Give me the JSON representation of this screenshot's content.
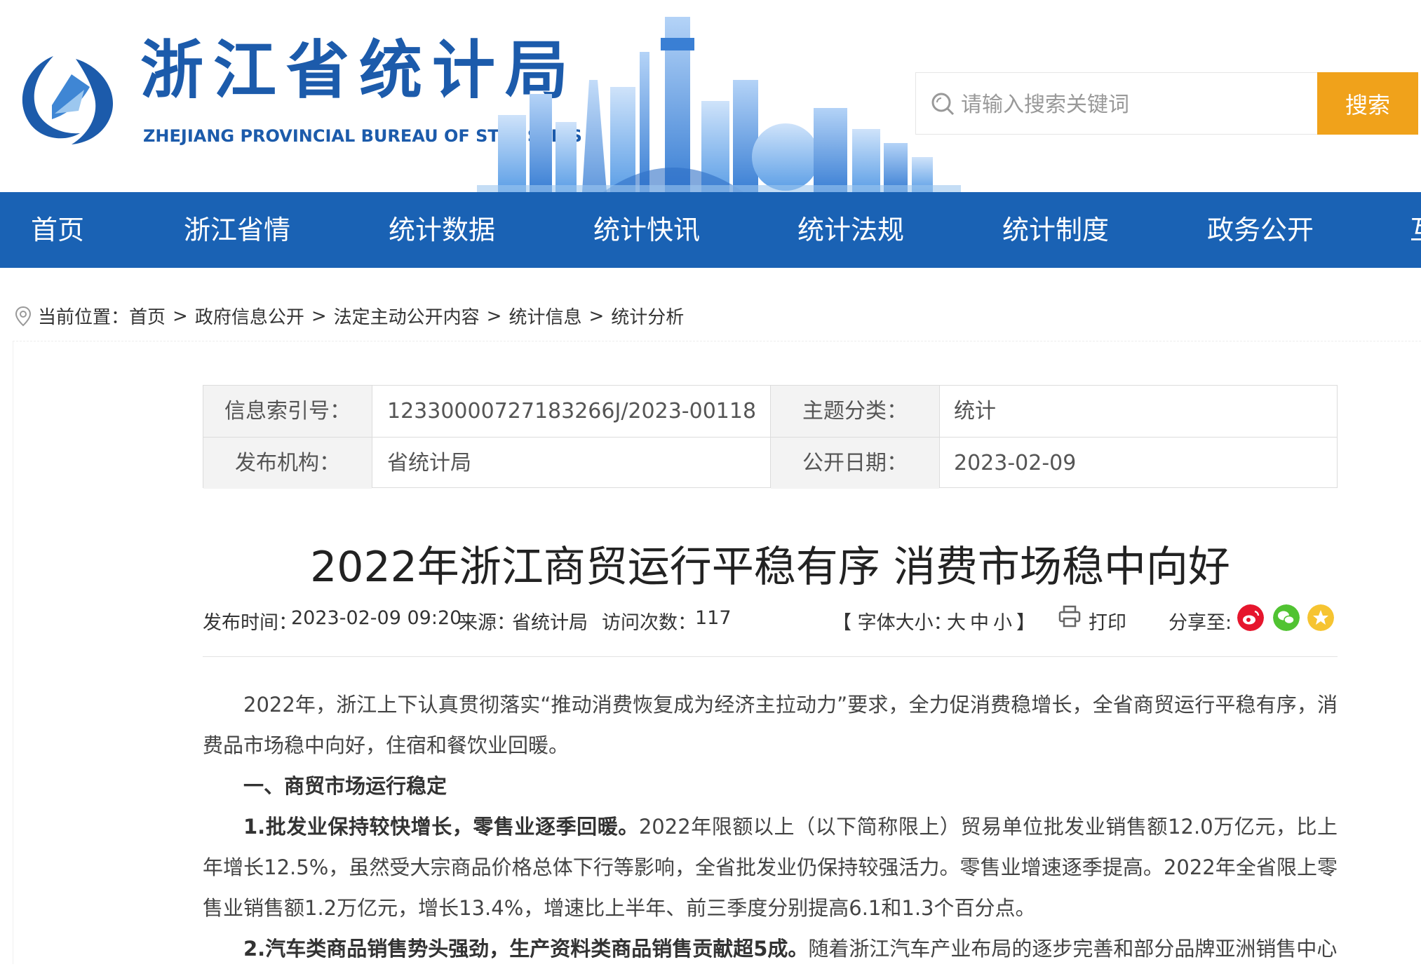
{
  "header": {
    "site_title": "浙江省统计局",
    "site_title_en": "ZHEJIANG PROVINCIAL BUREAU OF STATISTICS",
    "search_placeholder": "请输入搜索关键词",
    "search_button": "搜索",
    "accent": "#1c5bab",
    "search_button_color": "#f0a21b"
  },
  "nav": {
    "color": "#1a62b4",
    "items": [
      "首页",
      "浙江省情",
      "统计数据",
      "统计快讯",
      "统计法规",
      "统计制度",
      "政务公开",
      "互"
    ]
  },
  "breadcrumb": {
    "prefix": "当前位置：",
    "sep": ">",
    "items": [
      "首页",
      "政府信息公开",
      "法定主动公开内容",
      "统计信息",
      "统计分析"
    ]
  },
  "meta": {
    "index_label": "信息索引号：",
    "index_value": "12330000727183266J/2023-00118",
    "topic_label": "主题分类：",
    "topic_value": "统计",
    "org_label": "发布机构：",
    "org_value": "省统计局",
    "date_label": "公开日期：",
    "date_value": "2023-02-09"
  },
  "article": {
    "title": "2022年浙江商贸运行平稳有序 消费市场稳中向好",
    "publish_label": "发布时间：",
    "publish_time": "2023-02-09 09:20",
    "source_label": "来源：",
    "source": "省统计局",
    "views_label": "访问次数：",
    "views": "117",
    "font_size_label": "【 字体大小：",
    "font_large": "大",
    "font_medium": "中",
    "font_small": "小",
    "font_close": "】",
    "print": "打印",
    "share_label": "分享至:",
    "para1": "2022年，浙江上下认真贯彻落实“推动消费恢复成为经济主拉动力”要求，全力促消费稳增长，全省商贸运行平稳有序，消费品市场稳中向好，住宿和餐饮业回暖。",
    "heading1": "一、商贸市场运行稳定",
    "para2_bold": "1.批发业保持较快增长，零售业逐季回暖。",
    "para2": "2022年限额以上（以下简称限上）贸易单位批发业销售额12.0万亿元，比上年增长12.5%，虽然受大宗商品价格总体下行等影响，全省批发业仍保持较强活力。零售业增速逐季提高。2022年全省限上零售业销售额1.2万亿元，增长13.4%，增速比上半年、前三季度分别提高6.1和1.3个百分点。",
    "para3_bold": "2.汽车类商品销售势头强劲，生产资料类商品销售贡献超5成。",
    "para3": "随着浙江汽车产业布局的逐步完善和部分品牌亚洲销售中心"
  }
}
